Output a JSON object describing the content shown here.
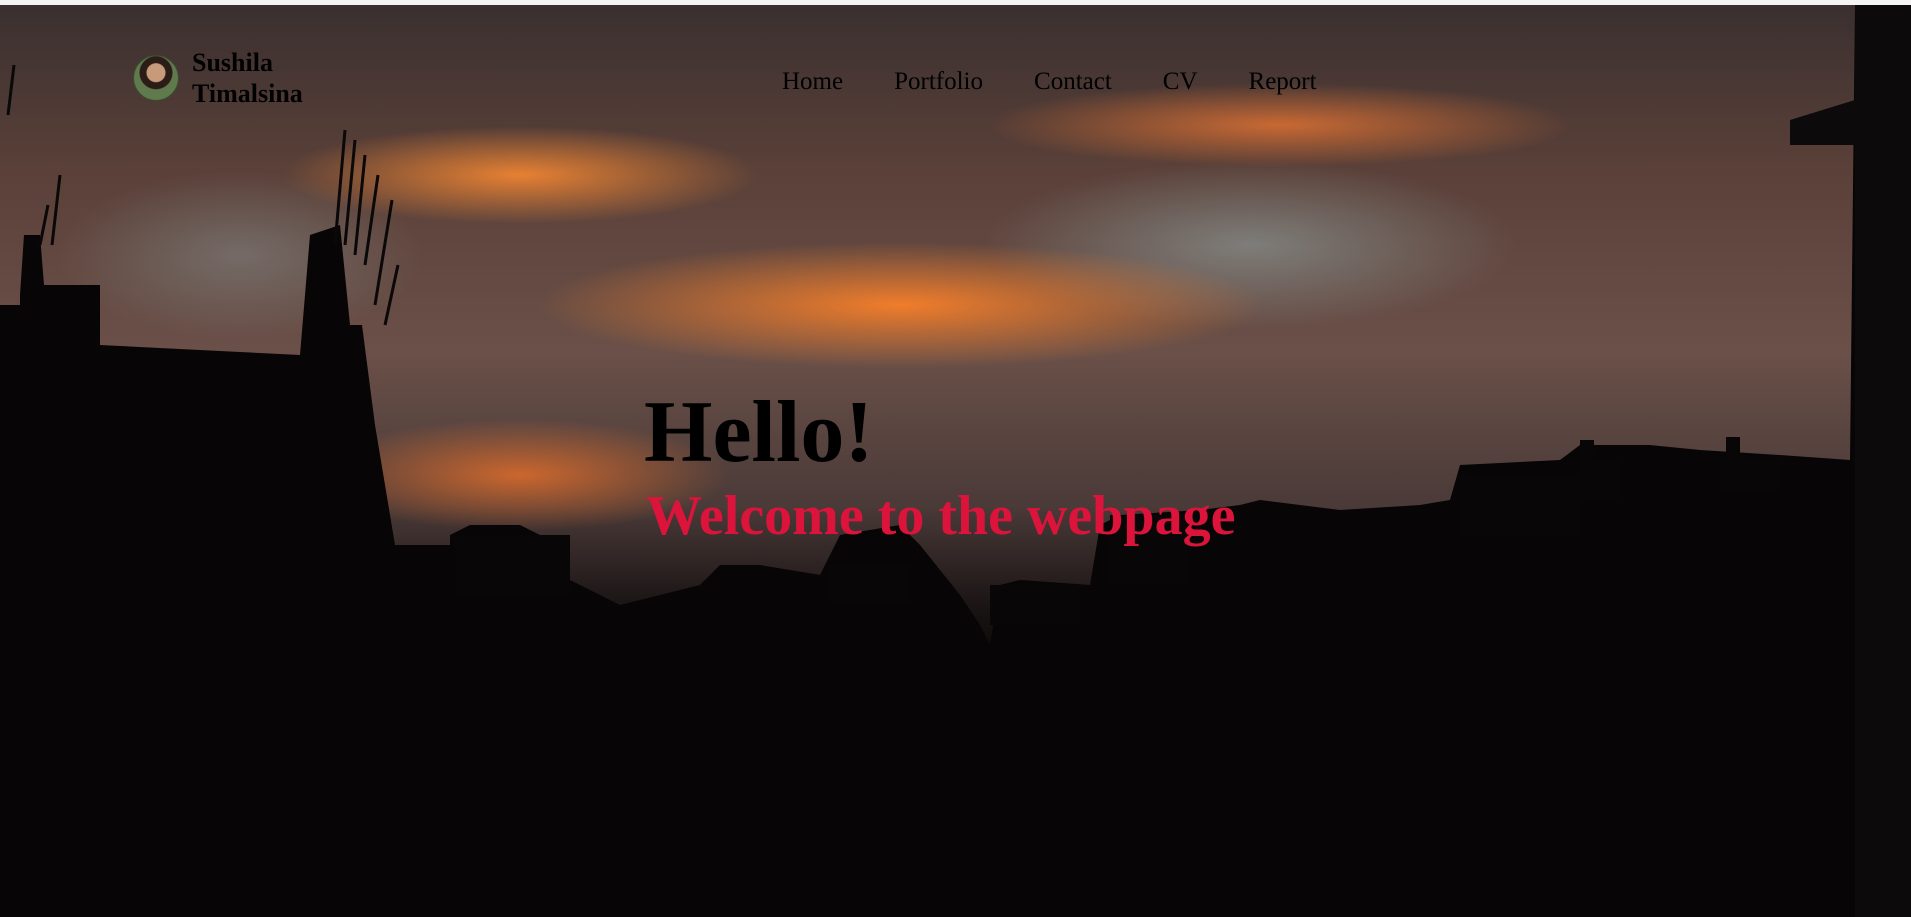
{
  "brand": {
    "name": "Sushila Timalsina",
    "avatar_icon": "profile-photo-avatar"
  },
  "nav": {
    "items": [
      {
        "label": "Home"
      },
      {
        "label": "Portfolio"
      },
      {
        "label": "Contact"
      },
      {
        "label": "CV"
      },
      {
        "label": "Report"
      }
    ]
  },
  "hero": {
    "greeting": "Hello!",
    "welcome": "Welcome to the webpage",
    "welcome_color": "#dc143c",
    "background": "sunset-sky-city-silhouette-photo"
  }
}
